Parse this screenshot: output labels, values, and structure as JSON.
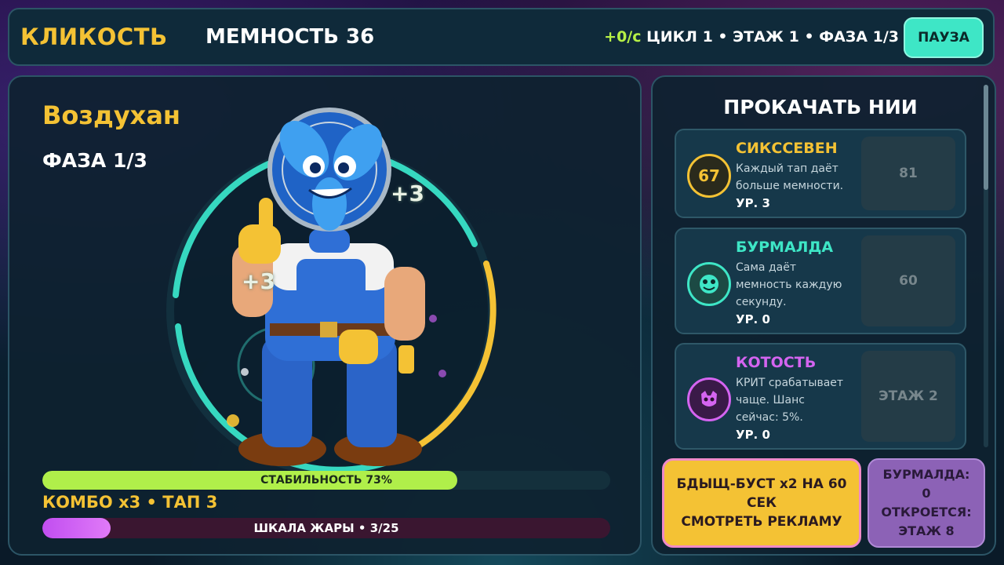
{
  "header": {
    "brand": "КЛИКОСТЬ",
    "memnost": "МЕМНОСТЬ  36",
    "rate": "+0/с",
    "status": "ЦИКЛ 1  •  ЭТАЖ 1  •  ФАЗА 1/3",
    "pause_label": "ПАУЗА"
  },
  "character": {
    "name": "Воздухан",
    "phase": "ФАЗА 1/3",
    "float_a": "+3",
    "float_b": "+3"
  },
  "stability": {
    "label": "СТАБИЛЬНОСТЬ  73%",
    "fraction": 0.73
  },
  "combo": "КОМБО х3  •  ТАП 3",
  "heat": {
    "label": "ШКАЛА ЖАРЫ • 3/25",
    "fraction": 0.12
  },
  "upgrades": {
    "title": "ПРОКАЧАТЬ НИИ",
    "items": [
      {
        "name": "СИКССЕВЕН",
        "desc": "Каждый тап даёт больше мемности.",
        "level": "УР. 3",
        "cost": "81",
        "icon_text": "67",
        "color": "#f4c234"
      },
      {
        "name": "БУРМАЛДА",
        "desc": "Сама даёт мемность каждую секунду.",
        "level": "УР. 0",
        "cost": "60",
        "icon_text": "",
        "color": "#3ee6c6"
      },
      {
        "name": "КОТОСТЬ",
        "desc": "КРИТ срабатывает чаще. Шанс сейчас: 5%.",
        "level": "УР. 0",
        "cost": "ЭТАЖ 2",
        "icon_text": "",
        "color": "#d464f0"
      }
    ]
  },
  "ad_button": {
    "line1": "БДЫЩ-БУСТ х2 НА 60 СЕК",
    "line2": "СМОТРЕТЬ РЕКЛАМУ"
  },
  "lock_info": {
    "line1": "БУРМАЛДА:",
    "line2": "0",
    "line3": "ОТКРОЕТСЯ:",
    "line4": "ЭТАЖ 8"
  }
}
